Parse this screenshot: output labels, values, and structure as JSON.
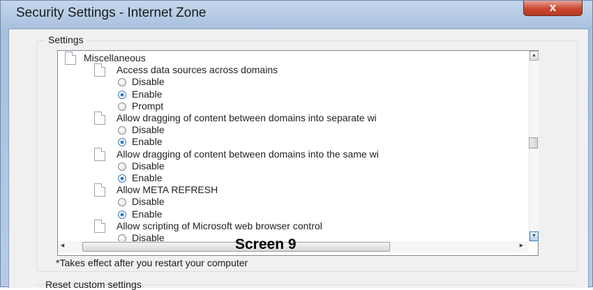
{
  "window": {
    "title": "Security Settings - Internet Zone",
    "close_glyph": "x"
  },
  "settings": {
    "group_label": "Settings",
    "items": [
      {
        "kind": "category",
        "label": "Miscellaneous",
        "icon": "page-icon"
      },
      {
        "kind": "setting",
        "label": "Access data sources across domains",
        "icon": "page-icon"
      },
      {
        "kind": "option",
        "label": "Disable",
        "checked": false
      },
      {
        "kind": "option",
        "label": "Enable",
        "checked": true
      },
      {
        "kind": "option",
        "label": "Prompt",
        "checked": false
      },
      {
        "kind": "setting",
        "label": "Allow dragging of content between domains into separate wi",
        "icon": "page-icon"
      },
      {
        "kind": "option",
        "label": "Disable",
        "checked": false
      },
      {
        "kind": "option",
        "label": "Enable",
        "checked": true
      },
      {
        "kind": "setting",
        "label": "Allow dragging of content between domains into the same wi",
        "icon": "page-icon"
      },
      {
        "kind": "option",
        "label": "Disable",
        "checked": false
      },
      {
        "kind": "option",
        "label": "Enable",
        "checked": true
      },
      {
        "kind": "setting",
        "label": "Allow META REFRESH",
        "icon": "page-icon"
      },
      {
        "kind": "option",
        "label": "Disable",
        "checked": false
      },
      {
        "kind": "option",
        "label": "Enable",
        "checked": true
      },
      {
        "kind": "setting",
        "label": "Allow scripting of Microsoft web browser control",
        "icon": "page-icon"
      },
      {
        "kind": "option",
        "label": "Disable",
        "checked": false
      }
    ],
    "footnote": "*Takes effect after you restart your computer"
  },
  "reset": {
    "group_label": "Reset custom settings"
  },
  "overlay": {
    "caption": "Screen 9"
  },
  "colors": {
    "title_bar": "#b7cbe4",
    "close_button": "#c9462f",
    "radio_checked": "#1a5fb4"
  }
}
